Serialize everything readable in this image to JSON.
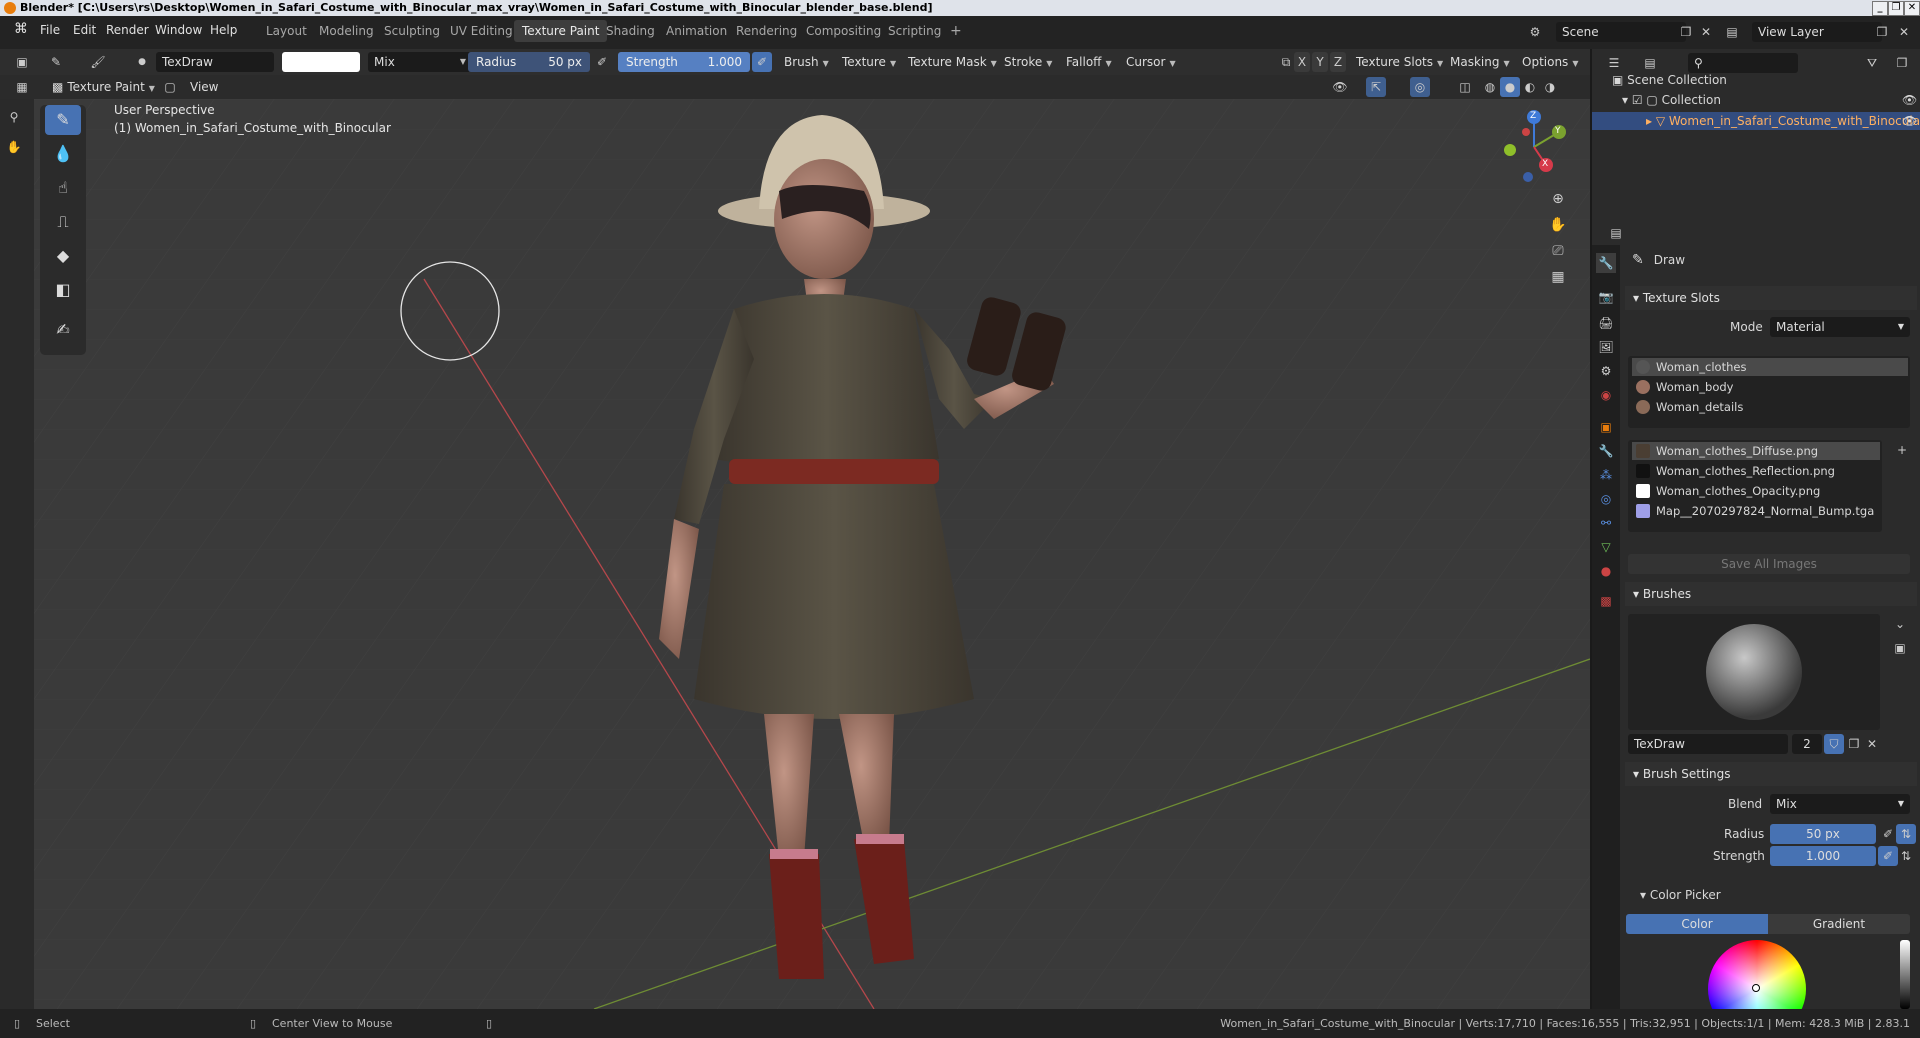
{
  "window": {
    "title": "Blender* [C:\\Users\\rs\\Desktop\\Women_in_Safari_Costume_with_Binocular_max_vray\\Women_in_Safari_Costume_with_Binocular_blender_base.blend]",
    "min": "_",
    "max": "❐",
    "close": "✕"
  },
  "menu": [
    "File",
    "Edit",
    "Render",
    "Window",
    "Help"
  ],
  "workspaces": [
    "Layout",
    "Modeling",
    "Sculpting",
    "UV Editing",
    "Texture Paint",
    "Shading",
    "Animation",
    "Rendering",
    "Compositing",
    "Scripting"
  ],
  "workspace_add": "+",
  "scene": {
    "label": "Scene",
    "view_layer": "View Layer"
  },
  "tool_header": {
    "brush_name": "TexDraw",
    "blend": "Mix",
    "radius_label": "Radius",
    "radius_value": "50 px",
    "strength_label": "Strength",
    "strength_value": "1.000",
    "menus": [
      "Brush",
      "Texture",
      "Texture Mask",
      "Stroke",
      "Falloff",
      "Cursor"
    ],
    "axes": [
      "X",
      "Y",
      "Z"
    ],
    "right_menus": [
      "Texture Slots",
      "Masking",
      "Options"
    ]
  },
  "mode_header": {
    "mode": "Texture Paint",
    "view": "View"
  },
  "viewport": {
    "perspective": "User Perspective",
    "object_label": "(1) Women_in_Safari_Costume_with_Binocular",
    "gizmo": {
      "x": "X",
      "y": "Y",
      "z": "Z"
    }
  },
  "outliner": {
    "root": "Scene Collection",
    "collection": "Collection",
    "object": "Women_in_Safari_Costume_with_Binocular"
  },
  "properties": {
    "tool_name": "Draw",
    "texture_slots": {
      "header": "Texture Slots",
      "mode_label": "Mode",
      "mode_value": "Material",
      "materials": [
        "Woman_clothes",
        "Woman_body",
        "Woman_details"
      ],
      "images": [
        "Woman_clothes_Diffuse.png",
        "Woman_clothes_Reflection.png",
        "Woman_clothes_Opacity.png",
        "Map__2070297824_Normal_Bump.tga"
      ],
      "save_all": "Save All Images"
    },
    "brushes": {
      "header": "Brushes",
      "name": "TexDraw",
      "users": "2"
    },
    "brush_settings": {
      "header": "Brush Settings",
      "blend_label": "Blend",
      "blend_value": "Mix",
      "radius_label": "Radius",
      "radius_value": "50 px",
      "strength_label": "Strength",
      "strength_value": "1.000"
    },
    "color_picker": {
      "header": "Color Picker",
      "tabs": [
        "Color",
        "Gradient"
      ]
    }
  },
  "statusbar": {
    "left": "Select",
    "middle": "Center View to Mouse",
    "stats": "Women_in_Safari_Costume_with_Binocular | Verts:17,710 | Faces:16,555 | Tris:32,951 | Objects:1/1 | Mem: 428.3 MiB | 2.83.1"
  },
  "colors": {
    "accent": "#4772b3",
    "active_slider": "#5680c2",
    "selection": "#4a4a4a",
    "orange": "#e87d0d"
  }
}
